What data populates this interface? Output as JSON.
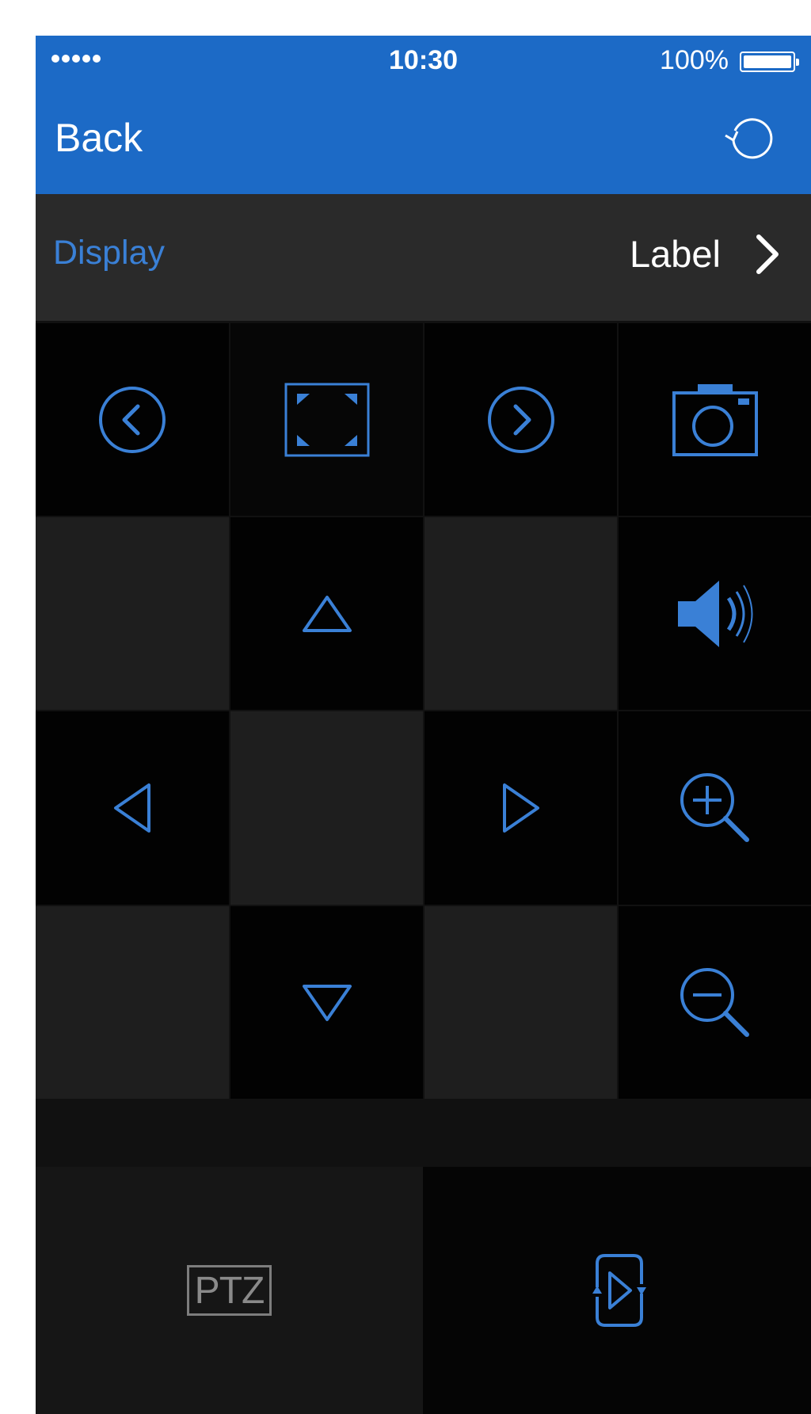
{
  "status_bar": {
    "time": "10:30",
    "battery": "100%"
  },
  "nav": {
    "back_label": "Back"
  },
  "display_row": {
    "title": "Display",
    "value": "Label"
  },
  "bottom": {
    "ptz_label": "PTZ"
  },
  "colors": {
    "accent": "#3a80d6",
    "header": "#1c6ac6"
  }
}
